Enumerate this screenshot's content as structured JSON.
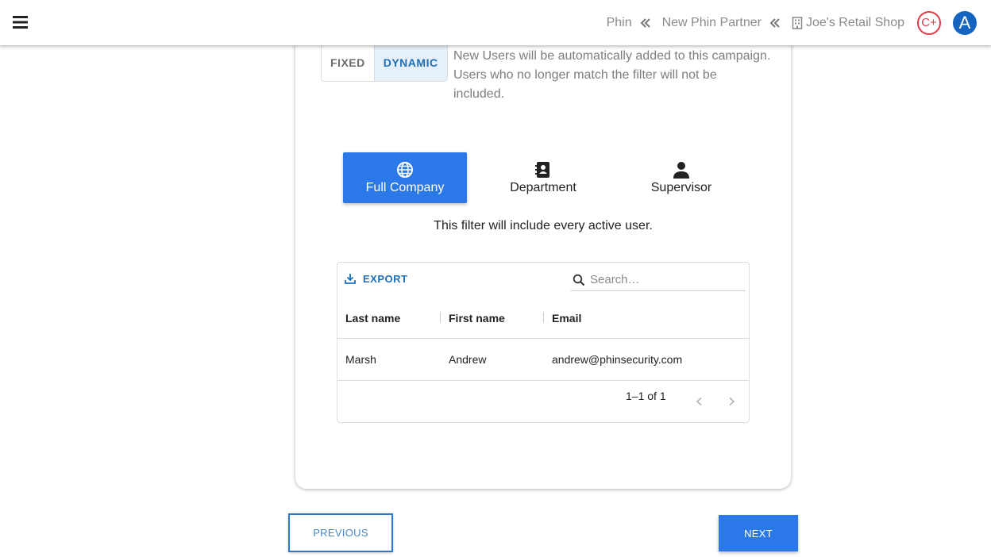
{
  "header": {
    "breadcrumbs": [
      {
        "label": "Phin"
      },
      {
        "label": "New Phin Partner"
      },
      {
        "label": "Joe's Retail Shop"
      }
    ],
    "badge_label": "C+",
    "avatar_initial": "A"
  },
  "audience": {
    "toggle": {
      "fixed_label": "FIXED",
      "dynamic_label": "DYNAMIC",
      "selected": "DYNAMIC"
    },
    "toggle_description": "New Users will be automatically added to this campaign. Users who no longer match the filter will not be included."
  },
  "filters": {
    "tabs": [
      {
        "label": "Full Company",
        "icon": "globe-icon",
        "active": true
      },
      {
        "label": "Department",
        "icon": "contact-book-icon",
        "active": false
      },
      {
        "label": "Supervisor",
        "icon": "person-icon",
        "active": false
      }
    ],
    "description": "This filter will include every active user."
  },
  "grid": {
    "export_label": "EXPORT",
    "search_placeholder": "Search…",
    "columns": [
      "Last name",
      "First name",
      "Email"
    ],
    "rows": [
      {
        "last_name": "Marsh",
        "first_name": "Andrew",
        "email": "andrew@phinsecurity.com"
      }
    ],
    "pagination": "1–1 of 1"
  },
  "nav": {
    "previous_label": "PREVIOUS",
    "next_label": "NEXT"
  },
  "colors": {
    "primary": "#2b79e8",
    "accent_text": "#1e6fb8",
    "badge_red": "#e53946",
    "avatar_blue": "#1565c0"
  }
}
